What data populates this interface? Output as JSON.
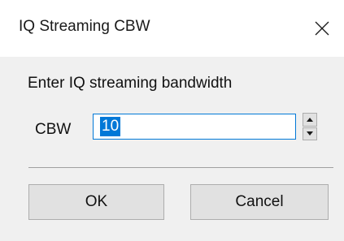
{
  "window": {
    "title": "IQ Streaming CBW",
    "close_icon": "close-x-icon"
  },
  "dialog": {
    "prompt": "Enter IQ streaming bandwidth",
    "cbw_label": "CBW",
    "cbw_value": "10",
    "spin_up_icon": "triangle-up-icon",
    "spin_down_icon": "triangle-down-icon"
  },
  "buttons": {
    "ok_label": "OK",
    "cancel_label": "Cancel"
  },
  "colors": {
    "selection": "#0078d7",
    "button_face": "#e1e1e1",
    "client_background": "#f0f0f0"
  }
}
